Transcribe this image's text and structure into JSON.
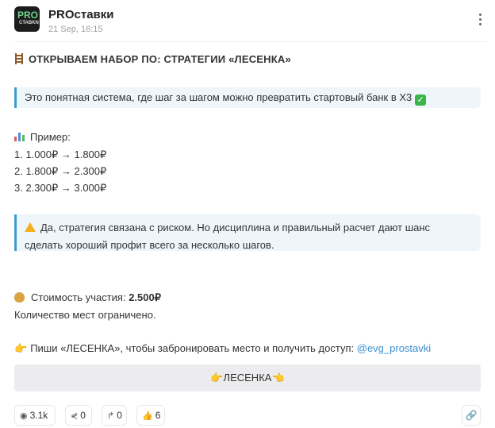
{
  "header": {
    "channel_name": "PROставки",
    "date": "21 Sep, 16:15",
    "avatar_text_top": "PRO",
    "avatar_text_bottom": "CTABKN"
  },
  "post": {
    "title": "ОТКРЫВАЕМ НАБОР ПО: СТРАТЕГИИ «ЛЕСЕНКА»",
    "quote1": "Это понятная система, где шаг за шагом можно превратить стартовый банк в Х3",
    "example_label": "Пример:",
    "examples": [
      "1. 1.000₽ → 1.800₽",
      "2. 1.800₽ → 2.300₽",
      "3. 2.300₽ → 3.000₽"
    ],
    "quote2_line1": "Да, стратегия связана с риском. Но дисциплина и правильный расчет дают шанс",
    "quote2_line2": "сделать хороший профит всего за несколько шагов.",
    "cost_label": "Стоимость участия: ",
    "cost_value": "2.500₽",
    "limited": "Количество мест ограничено.",
    "cta_text": "Пиши «ЛЕСЕНКА», чтобы забронировать место и получить доступ: ",
    "cta_link": "@evg_prostavki"
  },
  "button": {
    "label": "ЛЕСЕНКА"
  },
  "stats": {
    "views": "3.1k",
    "forwards": "0",
    "replies": "0",
    "likes": "6"
  },
  "colors": {
    "accent": "#3b9bd3",
    "quote_bg": "#eef6fb",
    "link": "#3a8fd1"
  }
}
